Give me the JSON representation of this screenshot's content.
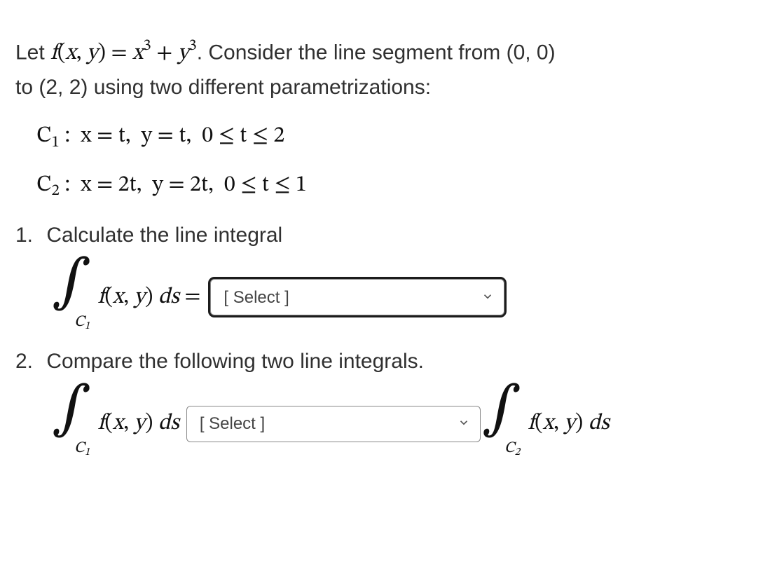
{
  "intro": {
    "let": "Let ",
    "func_def_lhs": "f(x, y)",
    "func_def_eq": " = ",
    "func_def_rhs_term1_base": "x",
    "func_def_rhs_term1_exp": "3",
    "func_def_rhs_plus": " + ",
    "func_def_rhs_term2_base": "y",
    "func_def_rhs_term2_exp": "3",
    "period": ". ",
    "sentence_rest_1": "Consider the line segment from (0, 0)",
    "sentence_rest_2": "to (2, 2) using two different parametrizations:"
  },
  "param": {
    "c1": "C₁ :  x = t,  y = t,  0 ≤ t ≤ 2",
    "c2": "C₂ :  x = 2t,  y = 2t,  0 ≤ t ≤ 1"
  },
  "q1": {
    "number": "1.",
    "text": "Calculate the line integral",
    "integral_lower_label": "C",
    "integral_lower_sub": "1",
    "integrand": "f(x, y) ds",
    "equals": " = ",
    "select_placeholder": "[ Select ]"
  },
  "q2": {
    "number": "2.",
    "text": "Compare the following two line integrals.",
    "left_lower_label": "C",
    "left_lower_sub": "1",
    "left_integrand": "f(x, y) ds",
    "select_placeholder": "[ Select ]",
    "right_lower_label": "C",
    "right_lower_sub": "2",
    "right_integrand": "f(x, y) ds"
  }
}
